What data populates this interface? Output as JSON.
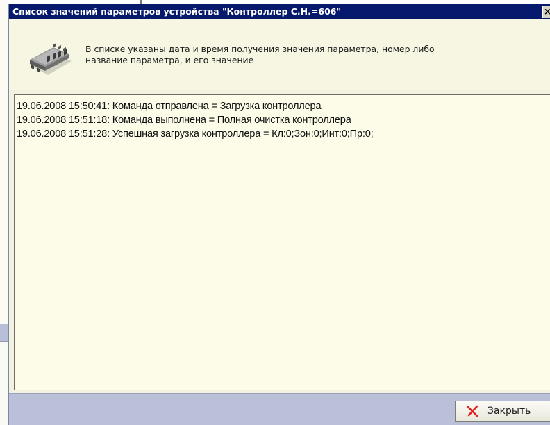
{
  "window": {
    "title": "Список значений параметров устройства \"Контроллер С.Н.=606\"",
    "close_glyph": "×"
  },
  "info": {
    "icon": "controller-chip-icon",
    "text_line1": "В списке указаны дата и время получения значения параметра, номер либо",
    "text_line2": "название параметра, и его значение"
  },
  "log": {
    "lines": [
      "19.06.2008 15:50:41: Команда отправлена = Загрузка контроллера",
      "19.06.2008 15:51:18: Команда выполнена = Полная очистка контроллера",
      "19.06.2008 15:51:28: Успешная загрузка контроллера = Кл:0;Зон:0;Инт:0;Пр:0;"
    ]
  },
  "footer": {
    "close_label": "Закрыть",
    "close_icon": "red-x-icon"
  },
  "colors": {
    "titlebar": "#07196d",
    "panel": "#f6f6e3",
    "log_bg": "#fcfce9",
    "footer": "#b9c0d8",
    "close_icon": "#e02020"
  }
}
